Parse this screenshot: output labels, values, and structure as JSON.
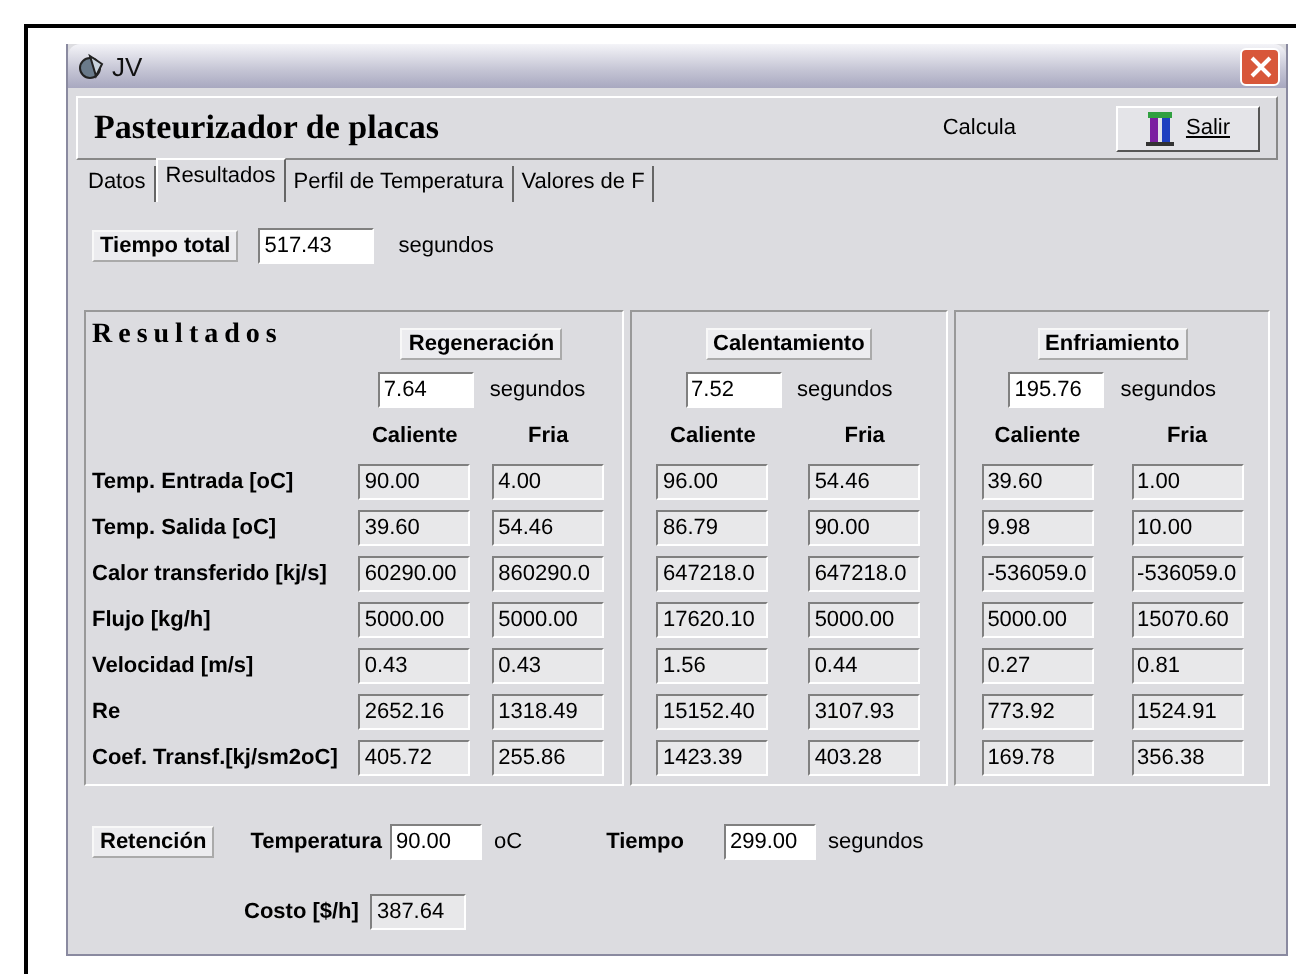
{
  "window": {
    "title": "JV"
  },
  "header": {
    "title": "Pasteurizador de placas",
    "status": "Calcula",
    "exit_button": "Salir"
  },
  "tabs": [
    {
      "label": "Datos",
      "selected": false
    },
    {
      "label": "Resultados",
      "selected": true
    },
    {
      "label": "Perfil de Temperatura",
      "selected": false
    },
    {
      "label": "Valores de  F",
      "selected": false
    }
  ],
  "total_time": {
    "label": "Tiempo total",
    "value": "517.43",
    "unit": "segundos"
  },
  "results": {
    "title": "Resultados",
    "stages": [
      {
        "name": "Regeneración",
        "time": "7.64",
        "unit": "segundos",
        "columns": [
          "Caliente",
          "Fria"
        ]
      },
      {
        "name": "Calentamiento",
        "time": "7.52",
        "unit": "segundos",
        "columns": [
          "Caliente",
          "Fria"
        ]
      },
      {
        "name": "Enfriamiento",
        "time": "195.76",
        "unit": "segundos",
        "columns": [
          "Caliente",
          "Fria"
        ]
      }
    ],
    "rows": [
      {
        "label": "Temp. Entrada [oC]",
        "values": [
          "90.00",
          "4.00",
          "96.00",
          "54.46",
          "39.60",
          "1.00"
        ]
      },
      {
        "label": "Temp. Salida [oC]",
        "values": [
          "39.60",
          "54.46",
          "86.79",
          "90.00",
          "9.98",
          "10.00"
        ]
      },
      {
        "label": "Calor transferido [kj/s]",
        "values": [
          "60290.00",
          "860290.0",
          "647218.0",
          "647218.0",
          "-536059.0",
          "-536059.0"
        ]
      },
      {
        "label": "Flujo [kg/h]",
        "values": [
          "5000.00",
          "5000.00",
          "17620.10",
          "5000.00",
          "5000.00",
          "15070.60"
        ]
      },
      {
        "label": "Velocidad [m/s]",
        "values": [
          "0.43",
          "0.43",
          "1.56",
          "0.44",
          "0.27",
          "0.81"
        ]
      },
      {
        "label": "Re",
        "values": [
          "2652.16",
          "1318.49",
          "15152.40",
          "3107.93",
          "773.92",
          "1524.91"
        ]
      },
      {
        "label": "Coef. Transf.[kj/sm2oC]",
        "values": [
          "405.72",
          "255.86",
          "1423.39",
          "403.28",
          "169.78",
          "356.38"
        ]
      }
    ]
  },
  "retention": {
    "title": "Retención",
    "temperature_label": "Temperatura",
    "temperature": "90.00",
    "temperature_unit": "oC",
    "time_label": "Tiempo",
    "time": "299.00",
    "time_unit": "segundos",
    "cost_label": "Costo [$/h]",
    "cost": "387.64"
  }
}
